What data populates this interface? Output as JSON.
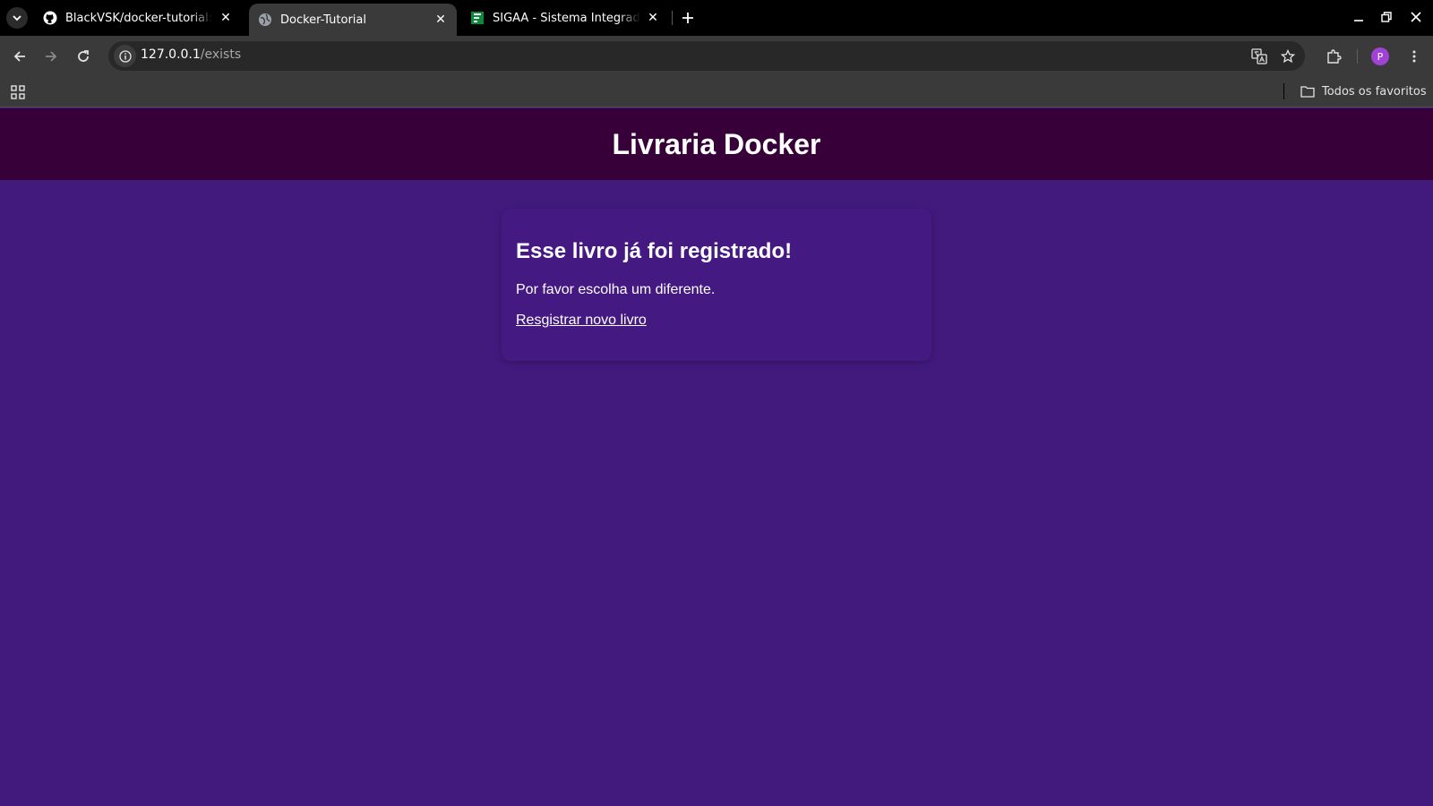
{
  "browser": {
    "tabs": [
      {
        "title": "BlackVSK/docker-tutorial: C",
        "icon": "github-icon",
        "active": false
      },
      {
        "title": "Docker-Tutorial",
        "icon": "globe-icon",
        "active": true
      },
      {
        "title": "SIGAA - Sistema Integrado",
        "icon": "sigaa-icon",
        "active": false
      }
    ],
    "address": {
      "host": "127.0.0.1",
      "path": "/exists"
    },
    "bookmarks": {
      "all_bookmarks_label": "Todos os favoritos"
    },
    "profile_initial": "P"
  },
  "page": {
    "site_title": "Livraria Docker",
    "card": {
      "heading": "Esse livro já foi registrado!",
      "message": "Por favor escolha um diferente.",
      "link_label": "Resgistrar novo livro"
    }
  },
  "colors": {
    "header_bg": "#370039",
    "page_bg": "#421a7e",
    "card_bg": "#441a82"
  }
}
